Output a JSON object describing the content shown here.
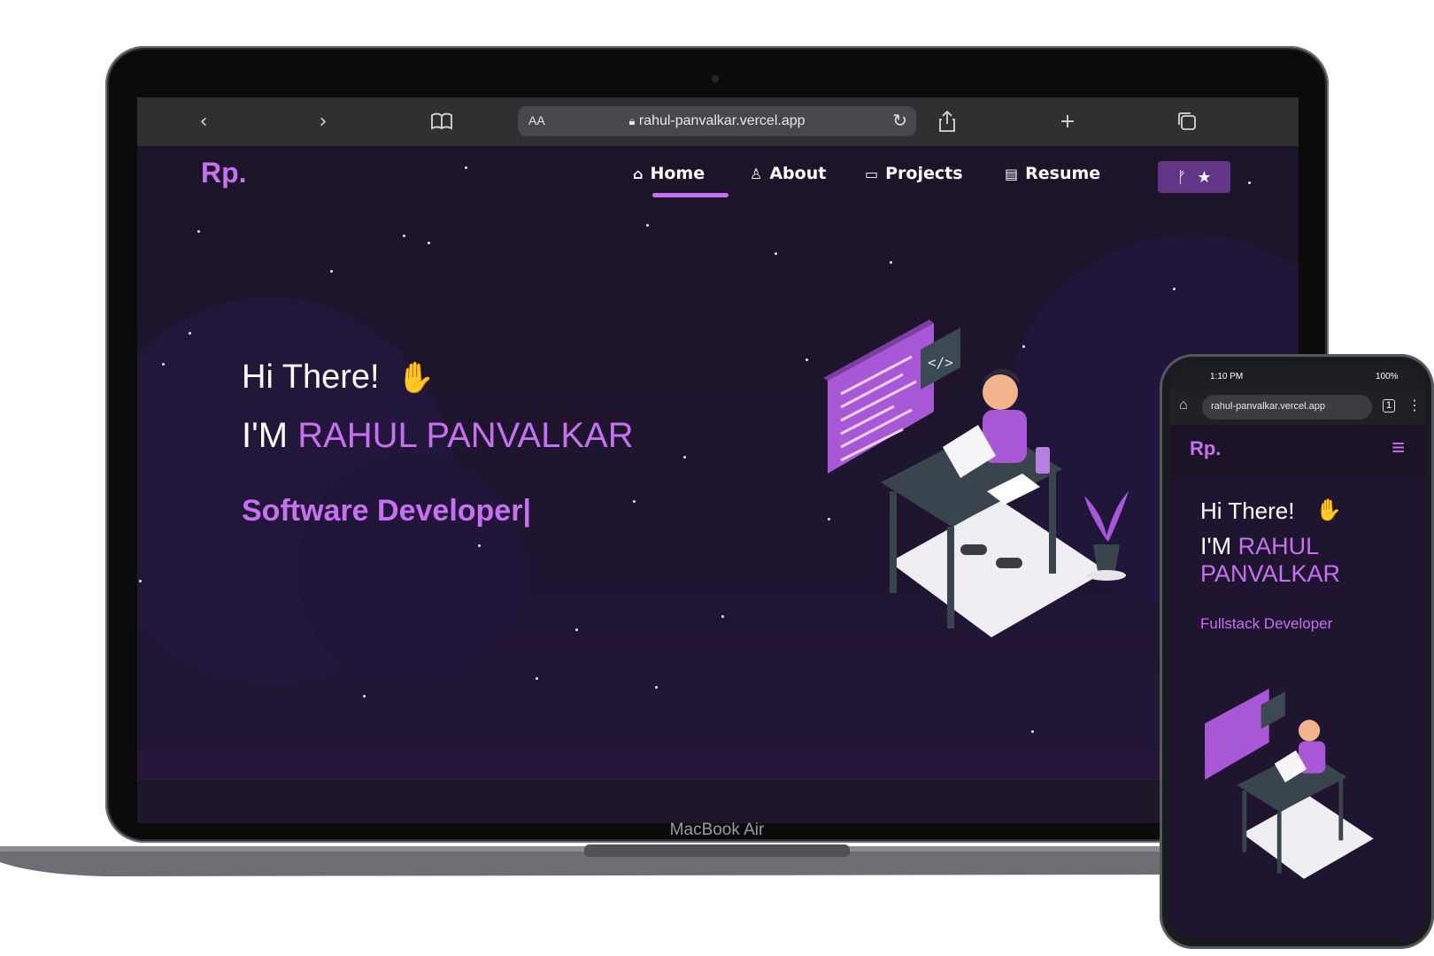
{
  "laptop": {
    "device_label": "MacBook Air",
    "browser": {
      "url_aa": "AA",
      "url": "rahul-panvalkar.vercel.app",
      "icons": [
        "back-icon",
        "forward-icon",
        "bookmarks-icon",
        "lock-icon",
        "reload-icon",
        "share-icon",
        "new-tab-icon",
        "tabs-icon"
      ]
    },
    "site": {
      "logo": "Rp.",
      "nav": [
        {
          "label": "Home",
          "icon": "home-icon"
        },
        {
          "label": "About",
          "icon": "user-icon"
        },
        {
          "label": "Projects",
          "icon": "projects-icon"
        },
        {
          "label": "Resume",
          "icon": "resume-icon"
        }
      ],
      "github_icon": "fork-icon",
      "star_icon": "star-icon",
      "hero": {
        "greeting": "Hi There!",
        "wave_icon": "wave-icon",
        "im": "I'M",
        "name": "RAHUL PANVALKAR",
        "role": "Software Developer|"
      }
    }
  },
  "phone": {
    "status_time": "1:10 PM",
    "status_battery": "100%",
    "url": "rahul-panvalkar.vercel.app",
    "tabs_count": "1",
    "logo": "Rp.",
    "menu_icon": "hamburger-icon",
    "hero": {
      "greeting": "Hi There!",
      "im": "I'M",
      "name_line1": "RAHUL",
      "name_line2": "PANVALKAR",
      "role": "Fullstack Developer"
    }
  },
  "colors": {
    "accent": "#c770f0",
    "background": "#1c1428",
    "button": "#623686"
  }
}
